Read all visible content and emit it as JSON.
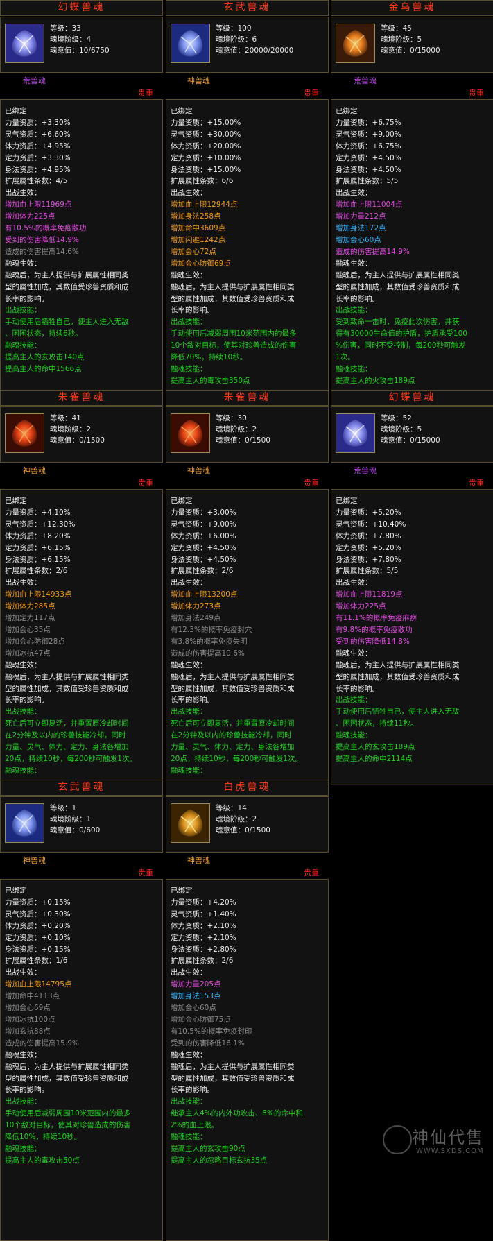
{
  "labels": {
    "level": "等级：",
    "realm": "魂境阶级：",
    "soul": "魂意值：",
    "rarity": "贵重"
  },
  "cards": [
    {
      "title": "幻蝶兽魂",
      "level": "33",
      "realm": "4",
      "soul": "10/6750",
      "type": "荒兽魂",
      "icon": "butterfly-soul-icon",
      "lines": [
        {
          "t": "已绑定",
          "c": "w"
        },
        {
          "t": "力量资质：+3.30%",
          "c": "w"
        },
        {
          "t": "灵气资质：+6.60%",
          "c": "w"
        },
        {
          "t": "体力资质：+4.95%",
          "c": "w"
        },
        {
          "t": "定力资质：+3.30%",
          "c": "w"
        },
        {
          "t": "身法资质：+4.95%",
          "c": "w"
        },
        {
          "t": "扩展属性条数：4/5",
          "c": "w"
        },
        {
          "t": "出战生效：",
          "c": "w"
        },
        {
          "t": "增加血上限11969点",
          "c": "m"
        },
        {
          "t": "增加体力225点",
          "c": "m"
        },
        {
          "t": "有10.5%的概率免疫散功",
          "c": "m"
        },
        {
          "t": "受到的伤害降低14.9%",
          "c": "m"
        },
        {
          "t": "造成的伤害提高14.6%",
          "c": "gd"
        },
        {
          "t": "融魂生效：",
          "c": "w"
        },
        {
          "t": "融魂后，为主人提供与扩展属性相同类",
          "c": "w"
        },
        {
          "t": "型的属性加成，其数值受珍兽资质和成",
          "c": "w"
        },
        {
          "t": "长率的影响。",
          "c": "w"
        },
        {
          "t": "出战技能：",
          "c": "g"
        },
        {
          "t": "手动使用后牺牲自己，使主人进入无敌",
          "c": "g"
        },
        {
          "t": "、困困状态，持续6秒。",
          "c": "g"
        },
        {
          "t": "融魂技能：",
          "c": "g"
        },
        {
          "t": "提高主人的玄攻击140点",
          "c": "g"
        },
        {
          "t": "提高主人的命中1566点",
          "c": "g"
        }
      ]
    },
    {
      "title": "玄武兽魂",
      "level": "100",
      "realm": "6",
      "soul": "20000/20000",
      "type": "神兽魂",
      "icon": "tortoise-soul-icon",
      "lines": [
        {
          "t": "已绑定",
          "c": "w"
        },
        {
          "t": "力量资质：+15.00%",
          "c": "w"
        },
        {
          "t": "灵气资质：+30.00%",
          "c": "w"
        },
        {
          "t": "体力资质：+20.00%",
          "c": "w"
        },
        {
          "t": "定力资质：+10.00%",
          "c": "w"
        },
        {
          "t": "身法资质：+15.00%",
          "c": "w"
        },
        {
          "t": "扩展属性条数：6/6",
          "c": "w"
        },
        {
          "t": "出战生效：",
          "c": "w"
        },
        {
          "t": "增加血上限12944点",
          "c": "o"
        },
        {
          "t": "增加身法258点",
          "c": "o"
        },
        {
          "t": "增加命中3609点",
          "c": "o"
        },
        {
          "t": "增加闪避1242点",
          "c": "o"
        },
        {
          "t": "增加会心72点",
          "c": "o"
        },
        {
          "t": "增加会心防御69点",
          "c": "o"
        },
        {
          "t": "融魂生效：",
          "c": "w"
        },
        {
          "t": "融魂后，为主人提供与扩展属性相同类",
          "c": "w"
        },
        {
          "t": "型的属性加成，其数值受珍兽资质和成",
          "c": "w"
        },
        {
          "t": "长率的影响。",
          "c": "w"
        },
        {
          "t": "出战技能：",
          "c": "g"
        },
        {
          "t": "手动使用后减弱周围10米范围内的最多",
          "c": "g"
        },
        {
          "t": "10个敌对目标，使其对珍兽造成的伤害",
          "c": "g"
        },
        {
          "t": "降低70%，持续10秒。",
          "c": "g"
        },
        {
          "t": "融魂技能：",
          "c": "g"
        },
        {
          "t": "提高主人的毒攻击350点",
          "c": "g"
        }
      ]
    },
    {
      "title": "金乌兽魂",
      "level": "45",
      "realm": "5",
      "soul": "0/15000",
      "type": "荒兽魂",
      "icon": "golden-crow-soul-icon",
      "lines": [
        {
          "t": "已绑定",
          "c": "w"
        },
        {
          "t": "力量资质：+6.75%",
          "c": "w"
        },
        {
          "t": "灵气资质：+9.00%",
          "c": "w"
        },
        {
          "t": "体力资质：+6.75%",
          "c": "w"
        },
        {
          "t": "定力资质：+4.50%",
          "c": "w"
        },
        {
          "t": "身法资质：+4.50%",
          "c": "w"
        },
        {
          "t": "扩展属性条数：5/5",
          "c": "w"
        },
        {
          "t": "出战生效：",
          "c": "w"
        },
        {
          "t": "增加血上限11004点",
          "c": "m"
        },
        {
          "t": "增加力量212点",
          "c": "m"
        },
        {
          "t": "增加身法172点",
          "c": "c"
        },
        {
          "t": "增加会心60点",
          "c": "c"
        },
        {
          "t": "造成的伤害提高14.9%",
          "c": "m"
        },
        {
          "t": "融魂生效：",
          "c": "w"
        },
        {
          "t": "融魂后，为主人提供与扩展属性相同类",
          "c": "w"
        },
        {
          "t": "型的属性加成，其数值受珍兽资质和成",
          "c": "w"
        },
        {
          "t": "长率的影响。",
          "c": "w"
        },
        {
          "t": "出战技能：",
          "c": "g"
        },
        {
          "t": "受到致命一击时，免疫此次伤害，并获",
          "c": "g"
        },
        {
          "t": "得有30000生命值的护盾，护盾承受100",
          "c": "g"
        },
        {
          "t": "%伤害，同时不受控制，每200秒可触发",
          "c": "g"
        },
        {
          "t": "1次。",
          "c": "g"
        },
        {
          "t": "融魂技能：",
          "c": "g"
        },
        {
          "t": "提高主人的火攻击189点",
          "c": "g"
        }
      ]
    },
    {
      "title": "朱雀兽魂",
      "level": "41",
      "realm": "2",
      "soul": "0/1500",
      "type": "神兽魂",
      "icon": "vermilion-bird-soul-icon",
      "lines": [
        {
          "t": "已绑定",
          "c": "w"
        },
        {
          "t": "力量资质：+4.10%",
          "c": "w"
        },
        {
          "t": "灵气资质：+12.30%",
          "c": "w"
        },
        {
          "t": "体力资质：+8.20%",
          "c": "w"
        },
        {
          "t": "定力资质：+6.15%",
          "c": "w"
        },
        {
          "t": "身法资质：+6.15%",
          "c": "w"
        },
        {
          "t": "扩展属性条数：2/6",
          "c": "w"
        },
        {
          "t": "出战生效：",
          "c": "w"
        },
        {
          "t": "增加血上限14933点",
          "c": "o"
        },
        {
          "t": "增加体力285点",
          "c": "o"
        },
        {
          "t": "增加定力117点",
          "c": "gd"
        },
        {
          "t": "增加会心35点",
          "c": "gd"
        },
        {
          "t": "增加会心防御28点",
          "c": "gd"
        },
        {
          "t": "增加冰抗47点",
          "c": "gd"
        },
        {
          "t": "融魂生效：",
          "c": "w"
        },
        {
          "t": "融魂后，为主人提供与扩展属性相同类",
          "c": "w"
        },
        {
          "t": "型的属性加成，其数值受珍兽资质和成",
          "c": "w"
        },
        {
          "t": "长率的影响。",
          "c": "w"
        },
        {
          "t": "出战技能：",
          "c": "g"
        },
        {
          "t": "死亡后可立即复活，并重置原冷却时间",
          "c": "g"
        },
        {
          "t": "在2分钟及以内的珍兽技能冷却，同时",
          "c": "g"
        },
        {
          "t": "力量、灵气、体力、定力、身法各增加",
          "c": "g"
        },
        {
          "t": "20点，持续10秒，每200秒可触发1次。",
          "c": "g"
        },
        {
          "t": "融魂技能：",
          "c": "g"
        }
      ]
    },
    {
      "title": "朱雀兽魂",
      "level": "30",
      "realm": "2",
      "soul": "0/1500",
      "type": "神兽魂",
      "icon": "vermilion-bird-soul-icon",
      "lines": [
        {
          "t": "已绑定",
          "c": "w"
        },
        {
          "t": "力量资质：+3.00%",
          "c": "w"
        },
        {
          "t": "灵气资质：+9.00%",
          "c": "w"
        },
        {
          "t": "体力资质：+6.00%",
          "c": "w"
        },
        {
          "t": "定力资质：+4.50%",
          "c": "w"
        },
        {
          "t": "身法资质：+4.50%",
          "c": "w"
        },
        {
          "t": "扩展属性条数：2/6",
          "c": "w"
        },
        {
          "t": "出战生效：",
          "c": "w"
        },
        {
          "t": "增加血上限13200点",
          "c": "o"
        },
        {
          "t": "增加体力273点",
          "c": "o"
        },
        {
          "t": "增加身法249点",
          "c": "gd"
        },
        {
          "t": "有12.3%的概率免疫封穴",
          "c": "gd"
        },
        {
          "t": "有3.8%的概率免疫失明",
          "c": "gd"
        },
        {
          "t": "造成的伤害提高10.6%",
          "c": "gd"
        },
        {
          "t": "融魂生效：",
          "c": "w"
        },
        {
          "t": "融魂后，为主人提供与扩展属性相同类",
          "c": "w"
        },
        {
          "t": "型的属性加成，其数值受珍兽资质和成",
          "c": "w"
        },
        {
          "t": "长率的影响。",
          "c": "w"
        },
        {
          "t": "出战技能：",
          "c": "g"
        },
        {
          "t": "死亡后可立即复活，并重置原冷却时间",
          "c": "g"
        },
        {
          "t": "在2分钟及以内的珍兽技能冷却，同时",
          "c": "g"
        },
        {
          "t": "力量、灵气、体力、定力、身法各增加",
          "c": "g"
        },
        {
          "t": "20点，持续10秒，每200秒可触发1次。",
          "c": "g"
        },
        {
          "t": "融魂技能：",
          "c": "g"
        }
      ]
    },
    {
      "title": "幻蝶兽魂",
      "level": "52",
      "realm": "5",
      "soul": "0/15000",
      "type": "荒兽魂",
      "icon": "butterfly-soul-icon",
      "lines": [
        {
          "t": "已绑定",
          "c": "w"
        },
        {
          "t": "力量资质：+5.20%",
          "c": "w"
        },
        {
          "t": "灵气资质：+10.40%",
          "c": "w"
        },
        {
          "t": "体力资质：+7.80%",
          "c": "w"
        },
        {
          "t": "定力资质：+5.20%",
          "c": "w"
        },
        {
          "t": "身法资质：+7.80%",
          "c": "w"
        },
        {
          "t": "扩展属性条数：5/5",
          "c": "w"
        },
        {
          "t": "出战生效：",
          "c": "w"
        },
        {
          "t": "增加血上限11819点",
          "c": "m"
        },
        {
          "t": "增加体力225点",
          "c": "m"
        },
        {
          "t": "有11.1%的概率免疫麻痹",
          "c": "m"
        },
        {
          "t": "有9.8%的概率免疫散功",
          "c": "m"
        },
        {
          "t": "受到的伤害降低14.8%",
          "c": "m"
        },
        {
          "t": "融魂生效：",
          "c": "w"
        },
        {
          "t": "融魂后，为主人提供与扩展属性相同类",
          "c": "w"
        },
        {
          "t": "型的属性加成，其数值受珍兽资质和成",
          "c": "w"
        },
        {
          "t": "长率的影响。",
          "c": "w"
        },
        {
          "t": "出战技能：",
          "c": "g"
        },
        {
          "t": "手动使用后牺牲自己，使主人进入无敌",
          "c": "g"
        },
        {
          "t": "、困困状态，持续11秒。",
          "c": "g"
        },
        {
          "t": "融魂技能：",
          "c": "g"
        },
        {
          "t": "提高主人的玄攻击189点",
          "c": "g"
        },
        {
          "t": "提高主人的命中2114点",
          "c": "g"
        }
      ]
    },
    {
      "title": "玄武兽魂",
      "level": "1",
      "realm": "1",
      "soul": "0/600",
      "type": "神兽魂",
      "icon": "tortoise-soul-icon",
      "lines": [
        {
          "t": "已绑定",
          "c": "w"
        },
        {
          "t": "力量资质：+0.15%",
          "c": "w"
        },
        {
          "t": "灵气资质：+0.30%",
          "c": "w"
        },
        {
          "t": "体力资质：+0.20%",
          "c": "w"
        },
        {
          "t": "定力资质：+0.10%",
          "c": "w"
        },
        {
          "t": "身法资质：+0.15%",
          "c": "w"
        },
        {
          "t": "扩展属性条数：1/6",
          "c": "w"
        },
        {
          "t": "出战生效：",
          "c": "w"
        },
        {
          "t": "增加血上限14795点",
          "c": "o"
        },
        {
          "t": "增加命中4113点",
          "c": "gd"
        },
        {
          "t": "增加会心69点",
          "c": "gd"
        },
        {
          "t": "增加冰抗100点",
          "c": "gd"
        },
        {
          "t": "增加玄抗88点",
          "c": "gd"
        },
        {
          "t": "造成的伤害提高15.9%",
          "c": "gd"
        },
        {
          "t": "融魂生效：",
          "c": "w"
        },
        {
          "t": "融魂后，为主人提供与扩展属性相同类",
          "c": "w"
        },
        {
          "t": "型的属性加成，其数值受珍兽资质和成",
          "c": "w"
        },
        {
          "t": "长率的影响。",
          "c": "w"
        },
        {
          "t": "出战技能：",
          "c": "g"
        },
        {
          "t": "手动使用后减弱周围10米范围内的最多",
          "c": "g"
        },
        {
          "t": "10个敌对目标，使其对珍兽造成的伤害",
          "c": "g"
        },
        {
          "t": "降低10%，持续10秒。",
          "c": "g"
        },
        {
          "t": "融魂技能：",
          "c": "g"
        },
        {
          "t": "提高主人的毒攻击50点",
          "c": "g"
        }
      ]
    },
    {
      "title": "白虎兽魂",
      "level": "14",
      "realm": "2",
      "soul": "0/1500",
      "type": "神兽魂",
      "icon": "white-tiger-soul-icon",
      "lines": [
        {
          "t": "已绑定",
          "c": "w"
        },
        {
          "t": "力量资质：+4.20%",
          "c": "w"
        },
        {
          "t": "灵气资质：+1.40%",
          "c": "w"
        },
        {
          "t": "体力资质：+2.10%",
          "c": "w"
        },
        {
          "t": "定力资质：+2.10%",
          "c": "w"
        },
        {
          "t": "身法资质：+2.80%",
          "c": "w"
        },
        {
          "t": "扩展属性条数：2/6",
          "c": "w"
        },
        {
          "t": "出战生效：",
          "c": "w"
        },
        {
          "t": "增加力量205点",
          "c": "m"
        },
        {
          "t": "增加身法153点",
          "c": "c"
        },
        {
          "t": "增加会心60点",
          "c": "gd"
        },
        {
          "t": "增加会心防御75点",
          "c": "gd"
        },
        {
          "t": "有10.5%的概率免疫封印",
          "c": "gd"
        },
        {
          "t": "受到的伤害降低16.1%",
          "c": "gd"
        },
        {
          "t": "融魂生效：",
          "c": "w"
        },
        {
          "t": "融魂后，为主人提供与扩展属性相同类",
          "c": "w"
        },
        {
          "t": "型的属性加成，其数值受珍兽资质和成",
          "c": "w"
        },
        {
          "t": "长率的影响。",
          "c": "w"
        },
        {
          "t": "出战技能：",
          "c": "g"
        },
        {
          "t": "继承主人4%的内外功攻击、8%的命中和",
          "c": "g"
        },
        {
          "t": "2%的血上限。",
          "c": "g"
        },
        {
          "t": "融魂技能：",
          "c": "g"
        },
        {
          "t": "提高主人的玄攻击90点",
          "c": "g"
        },
        {
          "t": "提高主人的忽略目标玄抗35点",
          "c": "g"
        }
      ]
    }
  ],
  "watermark": {
    "name": "神仙代售",
    "url": "WWW.SXDS.COM",
    "icon": "shenxian-logo-icon"
  },
  "colors": {
    "title": "#ff3a1c",
    "rarity": "#ff2020",
    "type_wild": "#b040e0",
    "type_divine": "#f0a030",
    "frame": "#5a4e2a"
  }
}
